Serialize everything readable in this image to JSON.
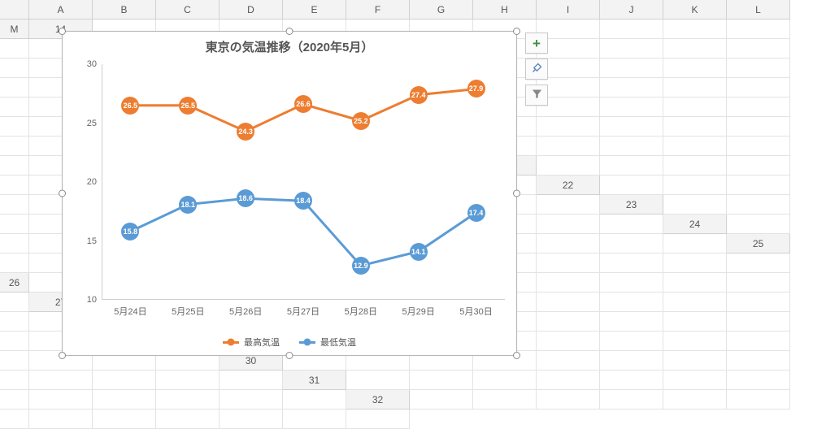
{
  "sheet": {
    "columns": [
      "A",
      "B",
      "C",
      "D",
      "E",
      "F",
      "G",
      "H",
      "I",
      "J",
      "K",
      "L",
      "M"
    ],
    "start_row": 14,
    "end_row": 32
  },
  "chart_data": {
    "type": "line",
    "title": "東京の気温推移（2020年5月）",
    "categories": [
      "5月24日",
      "5月25日",
      "5月26日",
      "5月27日",
      "5月28日",
      "5月29日",
      "5月30日"
    ],
    "series": [
      {
        "name": "最高気温",
        "color": "#ed7d31",
        "values": [
          26.5,
          26.5,
          24.3,
          26.6,
          25.2,
          27.4,
          27.9
        ]
      },
      {
        "name": "最低気温",
        "color": "#5b9bd5",
        "values": [
          15.8,
          18.1,
          18.6,
          18.4,
          12.9,
          14.1,
          17.4
        ]
      }
    ],
    "ylim": [
      10,
      30
    ],
    "yticks": [
      10,
      15,
      20,
      25,
      30
    ],
    "xlabel": "",
    "ylabel": "",
    "legend_position": "bottom",
    "grid": false
  },
  "side_tools": {
    "add_label": "グラフ要素を追加",
    "style_label": "グラフスタイル",
    "filter_label": "グラフフィルター"
  }
}
